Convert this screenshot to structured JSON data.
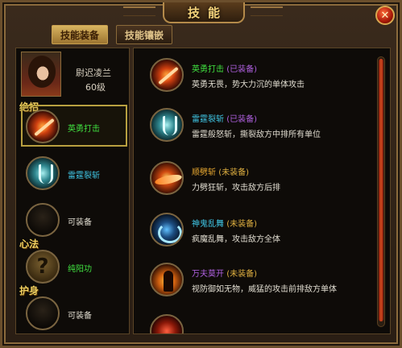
{
  "window": {
    "title": "技能",
    "close_symbol": "✕"
  },
  "tabs": [
    {
      "label": "技能装备",
      "active": true
    },
    {
      "label": "技能镶嵌",
      "active": false
    }
  ],
  "character": {
    "name": "尉迟凌兰",
    "level": "60级"
  },
  "left": {
    "section_juezhao": "绝招",
    "section_xinfa": "心法",
    "section_hushen": "护身",
    "slots": [
      {
        "label": "英勇打击",
        "icon": "fire-slash-icon",
        "color": "#40e040",
        "selected": true
      },
      {
        "label": "雷霆裂斩",
        "icon": "thunder-icon",
        "color": "#40c8e8"
      },
      {
        "label": "可装备",
        "icon": "empty-slot-icon",
        "color": "#e0dcd0"
      },
      {
        "label": "纯阳功",
        "icon": "question-icon",
        "color": "#40e040"
      },
      {
        "label": "可装备",
        "icon": "empty-slot-icon",
        "color": "#e0dcd0"
      }
    ]
  },
  "skills": [
    {
      "name": "英勇打击",
      "status": "(已装备)",
      "equipped": true,
      "name_color": "#40e040",
      "desc": "英勇无畏，势大力沉的单体攻击",
      "icon": "fire-slash-icon"
    },
    {
      "name": "雷霆裂斩",
      "status": "(已装备)",
      "equipped": true,
      "name_color": "#40c8e8",
      "desc": "雷霆般怒斩，撕裂敌方中排所有单位",
      "icon": "thunder-icon"
    },
    {
      "name": "顺劈斩",
      "status": "(未装备)",
      "equipped": false,
      "name_color": "#e8a830",
      "desc": "力劈狂斩，攻击敌方后排",
      "icon": "axe-icon"
    },
    {
      "name": "神鬼乱舞",
      "status": "(未装备)",
      "equipped": false,
      "name_color": "#40c8e8",
      "desc": "疯魔乱舞，攻击敌方全体",
      "icon": "ghost-icon"
    },
    {
      "name": "万夫莫开",
      "status": "(未装备)",
      "equipped": false,
      "name_color": "#b060e0",
      "desc": "视防御如无物，威猛的攻击前排敌方单体",
      "icon": "monk-icon"
    }
  ]
}
